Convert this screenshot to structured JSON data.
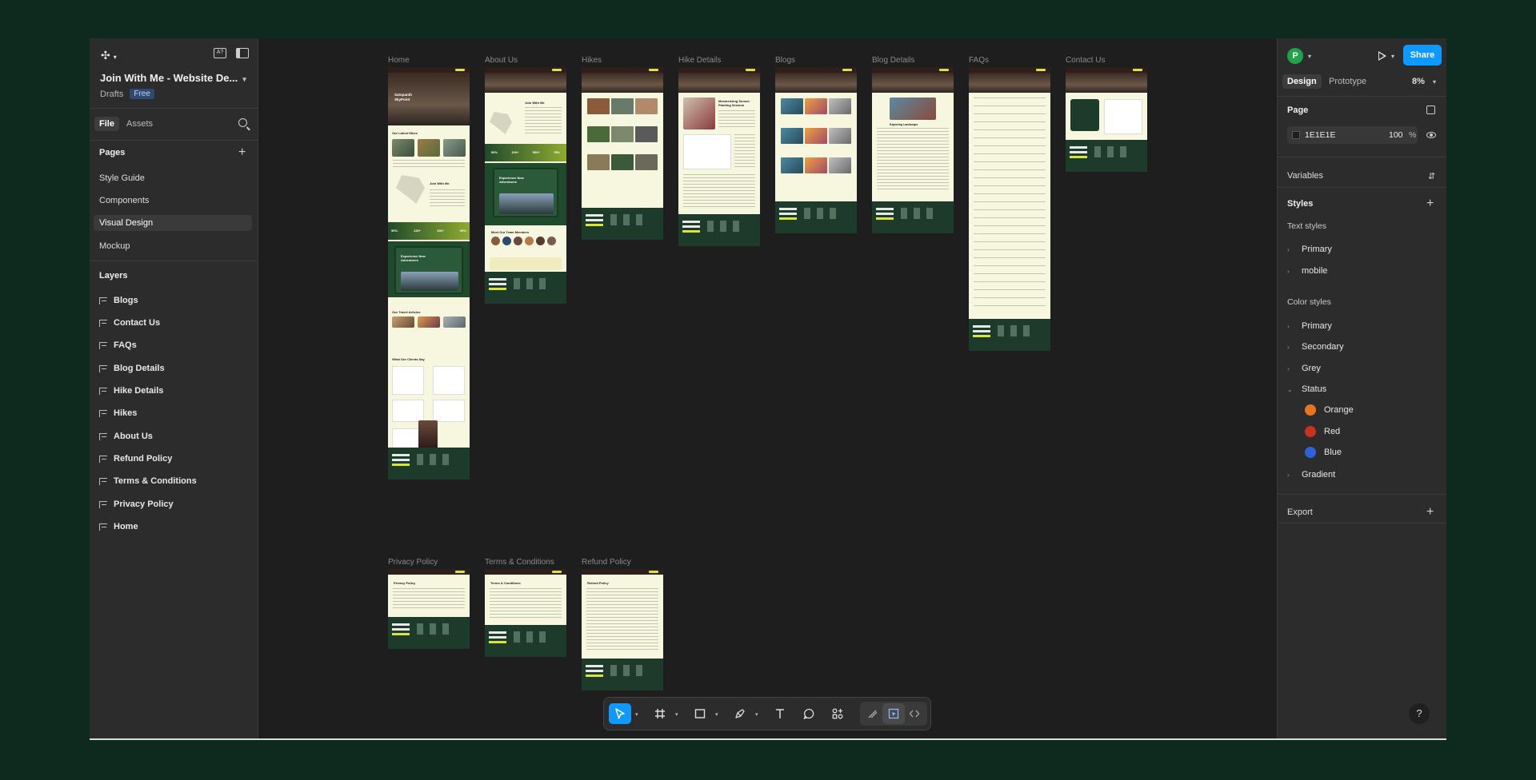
{
  "file": {
    "title": "Join With Me - Website De...",
    "location": "Drafts",
    "plan_badge": "Free"
  },
  "left_panel": {
    "tabs": [
      "File",
      "Assets"
    ],
    "pages_header": "Pages",
    "pages": [
      "Style Guide",
      "Components",
      "Visual Design",
      "Mockup"
    ],
    "active_page": "Visual Design",
    "layers_header": "Layers",
    "layers": [
      "Blogs",
      "Contact Us",
      "FAQs",
      "Blog Details",
      "Hike Details",
      "Hikes",
      "About Us",
      "Refund Policy",
      "Terms & Conditions",
      "Privacy Policy",
      "Home"
    ]
  },
  "right_panel": {
    "avatar_initial": "P",
    "share_label": "Share",
    "tabs": [
      "Design",
      "Prototype"
    ],
    "zoom": "8%",
    "page_section": "Page",
    "page_color_hex": "1E1E1E",
    "page_opacity": "100",
    "page_opacity_unit": "%",
    "variables_label": "Variables",
    "styles_label": "Styles",
    "text_styles_label": "Text styles",
    "text_styles": [
      "Primary",
      "mobile"
    ],
    "color_styles_label": "Color styles",
    "color_styles": [
      "Primary",
      "Secondary",
      "Grey",
      "Status"
    ],
    "status_colors": [
      {
        "name": "Orange",
        "color": "#e8741f"
      },
      {
        "name": "Red",
        "color": "#c8321f"
      },
      {
        "name": "Blue",
        "color": "#2f62d8"
      }
    ],
    "gradient_label": "Gradient",
    "export_label": "Export",
    "help_label": "?"
  },
  "canvas": {
    "frames_row1": [
      "Home",
      "About Us",
      "Hikes",
      "Hike Details",
      "Blogs",
      "Blog Details",
      "FAQs",
      "Contact Us"
    ],
    "frames_row2": [
      "Privacy Policy",
      "Terms & Conditions",
      "Refund Policy"
    ],
    "home_frame": {
      "hero_title_1": "Satopanth",
      "hero_title_2": "SkyPoint",
      "latest_hikes": "Our Latest Hikes",
      "join": "Join With Me",
      "stats": [
        "50%",
        "120+",
        "100+",
        "50%"
      ],
      "adventures": "Experience New Adventures",
      "articles": "Our Travel Articles",
      "clients": "What Our Clients Say"
    },
    "about_frame": {
      "join": "Join With Me",
      "stats": [
        "50%",
        "100+",
        "500+",
        "75%"
      ],
      "adventures": "Experience New Adventures",
      "team": "Meet Our Team Members"
    },
    "hike_details_frame": {
      "title": "Mesmerizing Sunset Painting Session"
    },
    "blog_details_frame": {
      "title": "Exploring Landscape"
    },
    "privacy_frame": {
      "title": "Privacy Policy"
    },
    "terms_frame": {
      "title": "Terms & Conditions"
    },
    "refund_frame": {
      "title": "Refund Policy"
    }
  },
  "toolbar": {
    "tools": [
      "move-tool",
      "frame-tool",
      "shape-tool",
      "pen-tool",
      "text-tool",
      "comment-tool",
      "actions-tool"
    ],
    "modes": [
      "draw-mode",
      "design-mode",
      "dev-mode"
    ]
  }
}
